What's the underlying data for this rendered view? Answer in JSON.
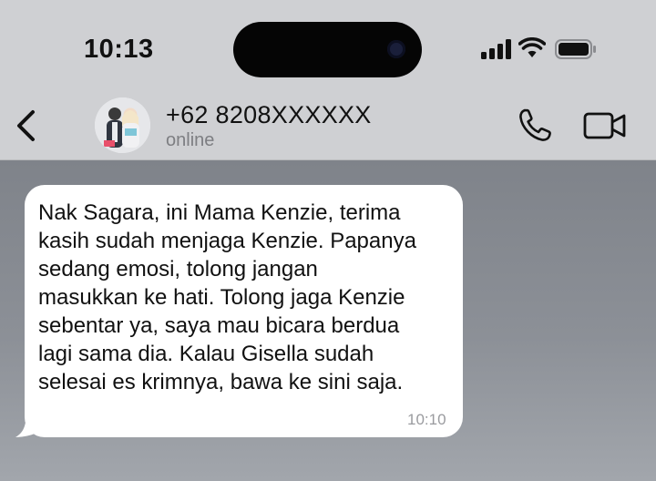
{
  "status_bar": {
    "time": "10:13"
  },
  "header": {
    "contact_name": "+62 8208XXXXXX",
    "contact_status": "online",
    "icons": {
      "back": "chevron-left-icon",
      "call": "phone-icon",
      "video": "video-camera-icon"
    }
  },
  "messages": [
    {
      "text": "Nak Sagara, ini Mama Kenzie, terima\nkasih sudah menjaga Kenzie. Papanya\nsedang emosi, tolong jangan\nmasukkan ke hati. Tolong jaga Kenzie\nsebentar ya, saya mau bicara berdua\nlagi sama dia. Kalau Gisella sudah\nselesai es krimnya, bawa ke sini saja.",
      "time": "10:10"
    }
  ],
  "colors": {
    "header_bg": "#cfd0d3",
    "chat_bg": "#8a8e95",
    "bubble_bg": "#ffffff",
    "text": "#111111",
    "muted": "#7d7e82"
  }
}
